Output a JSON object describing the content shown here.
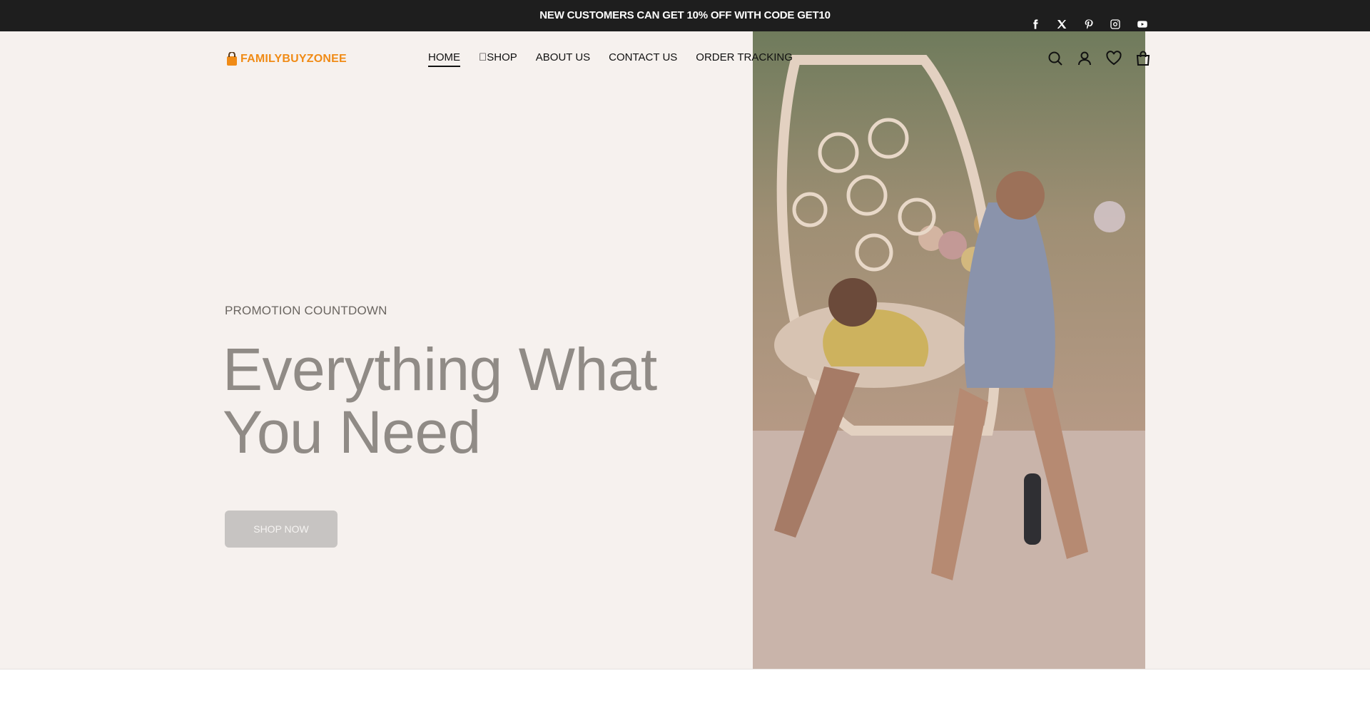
{
  "topbar": {
    "promo": "NEW CUSTOMERS CAN GET 10% OFF WITH CODE GET10",
    "socials": [
      {
        "icon": "facebook-icon"
      },
      {
        "icon": "x-twitter-icon"
      },
      {
        "icon": "pinterest-icon"
      },
      {
        "icon": "instagram-icon"
      },
      {
        "icon": "youtube-icon"
      }
    ]
  },
  "header": {
    "logo_text": "FAMILYBUYZONEE",
    "menu": [
      {
        "label": "HOME",
        "active": true
      },
      {
        "label": "SHOP",
        "active": false
      },
      {
        "label": "ABOUT US",
        "active": false
      },
      {
        "label": "CONTACT US",
        "active": false
      },
      {
        "label": "ORDER TRACKING",
        "active": false
      }
    ],
    "icons": [
      "search-icon",
      "account-icon",
      "wishlist-heart-icon",
      "cart-bag-icon"
    ]
  },
  "hero": {
    "eyebrow": "PROMOTION COUNTDOWN",
    "title_line1": "Everything What",
    "title_line2": "You Need",
    "cta_label": "SHOP NOW",
    "image_alt_icon": "party-photo"
  },
  "colors": {
    "topbar_bg": "#1e1e1e",
    "hero_bg": "#f6f1ee",
    "logo_orange": "#f08b16",
    "button_bg": "#c7c4c2"
  }
}
